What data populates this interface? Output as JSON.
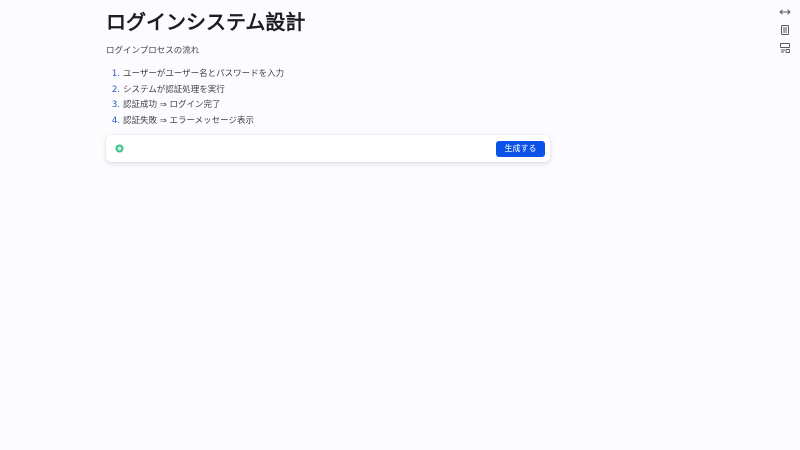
{
  "document": {
    "title": "ログインシステム設計",
    "subtitle": "ログインプロセスの流れ",
    "steps": [
      {
        "num": "1.",
        "text": "ユーザーがユーザー名とパスワードを入力"
      },
      {
        "num": "2.",
        "text": "システムが認証処理を実行"
      },
      {
        "num": "3.",
        "text": "認証成功 ⇒ ログイン完了"
      },
      {
        "num": "4.",
        "text": "認証失敗 ⇒ エラーメッセージ表示"
      }
    ]
  },
  "generator": {
    "icon": "sparkle-icon",
    "accent_color": "#3dbf8c",
    "input_value": "",
    "button_label": "生成する",
    "button_color": "#0b52e8"
  },
  "side_toolbar": {
    "icons": [
      "expand-width-icon",
      "document-icon",
      "layout-icon"
    ]
  },
  "colors": {
    "background": "#fcfbfe",
    "title": "#1e1e22",
    "list_number": "#2d56c8"
  }
}
